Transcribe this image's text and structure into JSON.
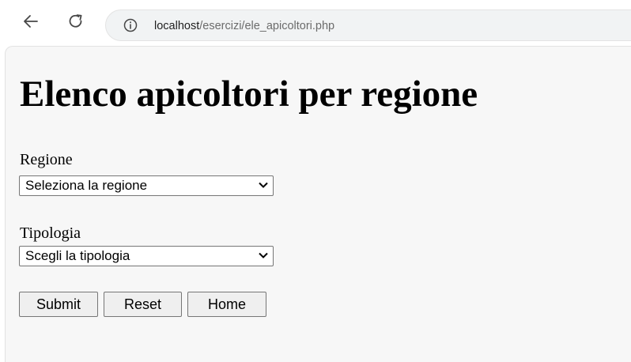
{
  "browser": {
    "url_host": "localhost",
    "url_path": "/esercizi/ele_apicoltori.php",
    "back_icon": "arrow-left",
    "reload_icon": "reload",
    "info_icon": "info-circle"
  },
  "page": {
    "title": "Elenco apicoltori per regione",
    "regione": {
      "label": "Regione",
      "selected": "Seleziona la regione"
    },
    "tipologia": {
      "label": "Tipologia",
      "selected": "Scegli la tipologia"
    },
    "buttons": {
      "submit": "Submit",
      "reset": "Reset",
      "home": "Home"
    }
  }
}
